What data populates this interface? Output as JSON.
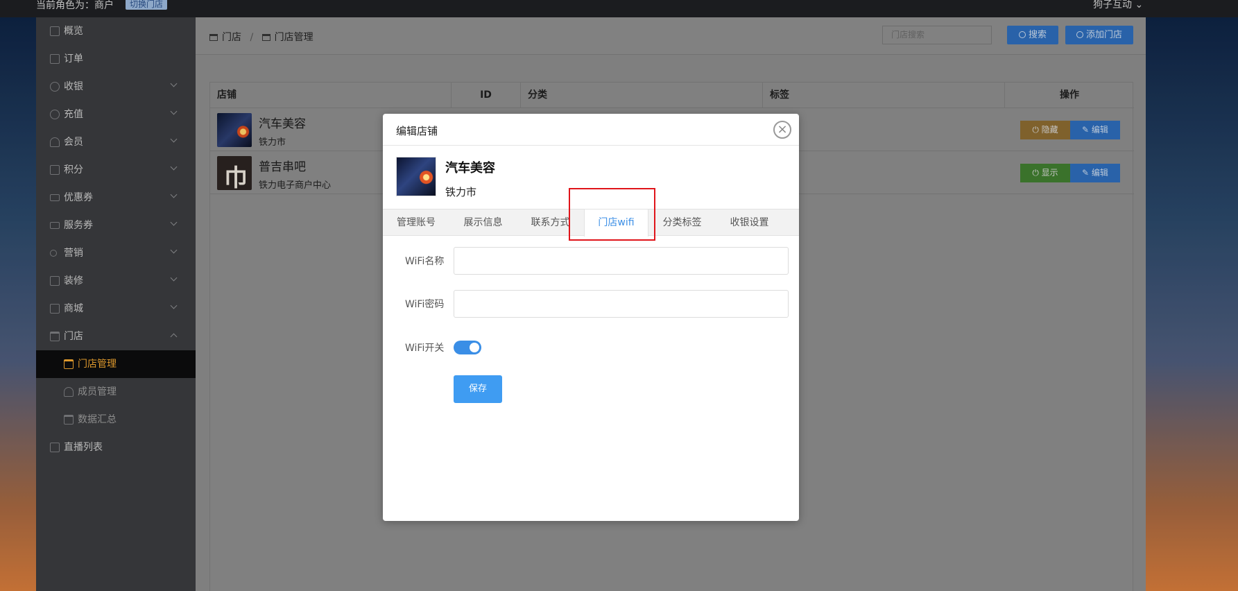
{
  "topbar": {
    "role": "当前角色为：商户",
    "switch": "切换门店",
    "user": "狗子互动"
  },
  "sidebar": {
    "items": [
      {
        "label": "概览"
      },
      {
        "label": "订单"
      },
      {
        "label": "收银"
      },
      {
        "label": "充值"
      },
      {
        "label": "会员"
      },
      {
        "label": "积分"
      },
      {
        "label": "优惠券"
      },
      {
        "label": "服务券"
      },
      {
        "label": "营销"
      },
      {
        "label": "装修"
      },
      {
        "label": "商城"
      },
      {
        "label": "门店"
      },
      {
        "label": "门店管理"
      },
      {
        "label": "成员管理"
      },
      {
        "label": "数据汇总"
      },
      {
        "label": "直播列表"
      }
    ]
  },
  "header": {
    "breadcrumb": [
      "门店",
      "/",
      "门店管理"
    ],
    "search_placeholder": "门店搜索",
    "search_btn": "搜索",
    "add_btn": "添加门店"
  },
  "table": {
    "columns": [
      "店铺",
      "ID",
      "分类",
      "标签",
      "操作"
    ],
    "rows": [
      {
        "name": "汽车美容",
        "city": "铁力市",
        "op1": "隐藏",
        "op2": "编辑"
      },
      {
        "name": "普吉串吧",
        "city": "铁力电子商户中心",
        "op1": "显示",
        "op2": "编辑"
      }
    ]
  },
  "modal": {
    "title": "编辑店铺",
    "close": "×",
    "store_name": "汽车美容",
    "store_city": "铁力市",
    "tabs": [
      "管理账号",
      "展示信息",
      "联系方式",
      "门店wifi",
      "分类标签",
      "收银设置"
    ],
    "fields": {
      "wifi_name_label": "WiFi名称",
      "wifi_pwd_label": "WiFi密码",
      "wifi_switch_label": "WiFi开关"
    },
    "save": "保存"
  },
  "colors": {
    "accent": "#3a8ee6",
    "highlight": "#e0141a",
    "active_nav": "#f0a531"
  }
}
